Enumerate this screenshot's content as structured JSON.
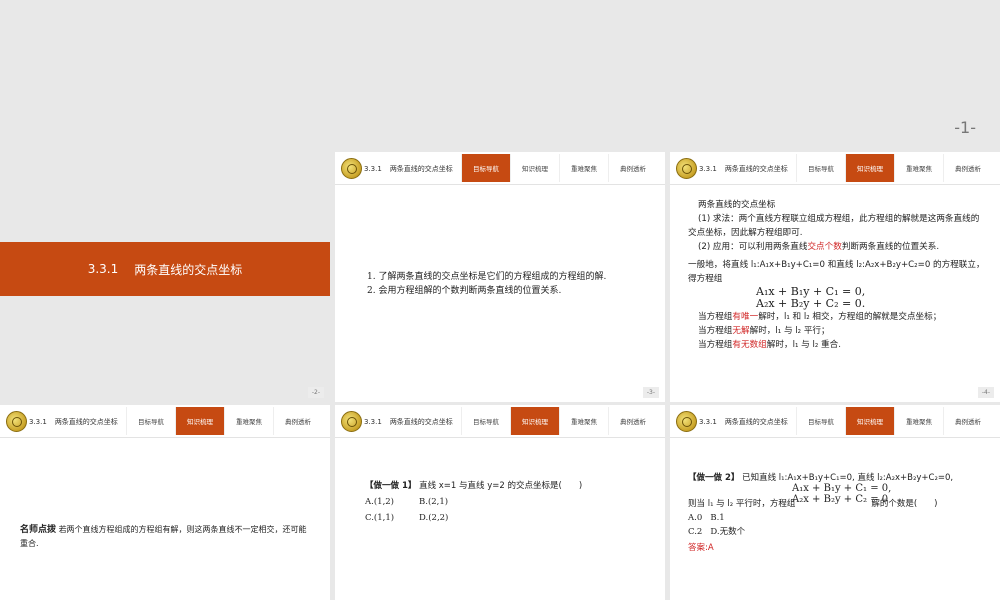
{
  "page_number": "-1-",
  "header": {
    "section": "3.3.1",
    "title": "两条直线的交点坐标",
    "tabs": [
      "目标导航",
      "知识梳理",
      "重难聚焦",
      "典例透析"
    ]
  },
  "slide1": {
    "section": "3.3.1",
    "title": "两条直线的交点坐标",
    "num": "-2-"
  },
  "slide2": {
    "num": "-3-",
    "objectives": [
      "1. 了解两条直线的交点坐标是它们的方程组成的方程组的解.",
      "2. 会用方程组解的个数判断两条直线的位置关系."
    ]
  },
  "slide3": {
    "num": "-4-",
    "heading": "两条直线的交点坐标",
    "p1": "(1) 求法：两个直线方程联立组成方程组，此方程组的解就是这两条直线的交点坐标，因此解方程组即可.",
    "p2a": "(2) 应用：可以利用两条直线",
    "p2red": "交点个数",
    "p2b": "判断两条直线的位置关系.",
    "p3a": "一般地，将直线 l₁:A₁x+B₁y+C₁=0 和直线 l₂:A₂x+B₂y+C₂=0 的方程联立，得方程组",
    "eq1": "A₁x + B₁y + C₁ = 0,",
    "eq2": "A₂x + B₂y + C₂ = 0.",
    "c1a": "当方程组",
    "c1red": "有唯一",
    "c1b": "解时，l₁ 和 l₂ 相交，方程组的解就是交点坐标；",
    "c2a": "当方程组",
    "c2red": "无解",
    "c2b": "解时，l₁ 与 l₂ 平行；",
    "c3a": "当方程组",
    "c3red": "有无数组",
    "c3b": "解时，l₁ 与 l₂ 重合."
  },
  "slide4": {
    "label": "名师点拨",
    "text": "若两个直线方程组成的方程组有解，则这两条直线不一定相交，还可能重合."
  },
  "slide5": {
    "tag": "【做一做 1】",
    "question": "直线 x=1 与直线 y=2 的交点坐标是(　　)",
    "options": [
      "A.(1,2)",
      "B.(2,1)",
      "C.(1,1)",
      "D.(2,2)"
    ]
  },
  "slide6": {
    "tag": "【做一做 2】",
    "q1": "已知直线 l₁:A₁x+B₁y+C₁=0, 直线 l₂:A₂x+B₂y+C₂=0,",
    "q2a": "则当 l₁ 与 l₂ 平行时，方程组",
    "q2b": "解的个数是(　　)",
    "eq1": "A₁x + B₁y + C₁ = 0,",
    "eq2": "A₂x + B₂y + C₂ = 0",
    "options": [
      "A.0",
      "B.1",
      "C.2",
      "D.无数个"
    ],
    "answer": "答案:A"
  }
}
